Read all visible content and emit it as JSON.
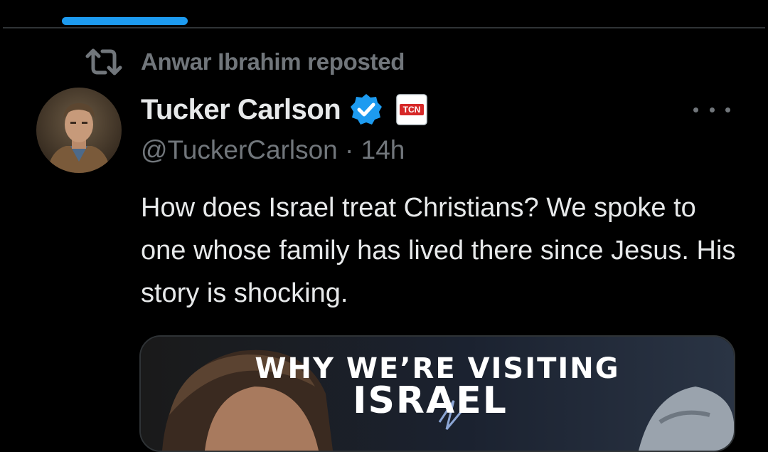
{
  "repost": {
    "text": "Anwar Ibrahim reposted",
    "icon": "repost-icon"
  },
  "author": {
    "display_name": "Tucker Carlson",
    "handle": "@TuckerCarlson",
    "time": "14h",
    "verified_icon": "verified-badge-icon",
    "affiliate_badge_text": "TCN"
  },
  "tweet": {
    "text": "How does Israel treat Christians? We spoke to one whose family has lived there since Jesus. His story is shocking."
  },
  "media": {
    "line1": "WHY WE’RE VISITING",
    "line2": "ISRAEL"
  },
  "more_icon": "more-horizontal-icon",
  "colors": {
    "accent": "#1d9bf0",
    "secondary_text": "#71767b",
    "primary_text": "#e7e9ea",
    "divider": "#2f3336",
    "background": "#000000"
  }
}
